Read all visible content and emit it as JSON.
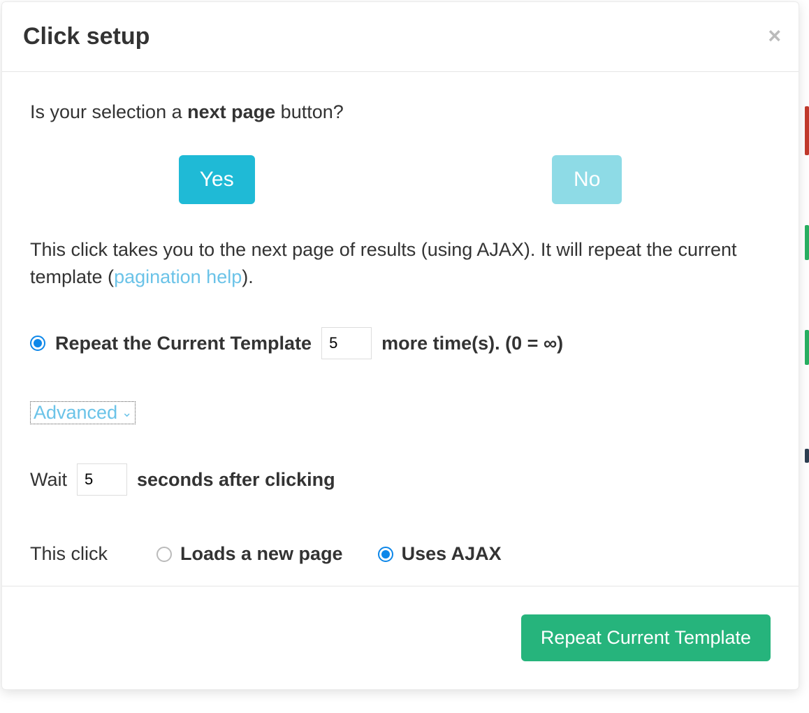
{
  "modal": {
    "title": "Click setup",
    "question_prefix": "Is your selection a ",
    "question_bold": "next page",
    "question_suffix": " button?",
    "yes_label": "Yes",
    "no_label": "No",
    "desc_part1": "This click takes you to the next page of results (using AJAX). It will repeat the current template (",
    "desc_link": "pagination help",
    "desc_part2": ").",
    "repeat_label": "Repeat the Current Template",
    "repeat_value": "5",
    "repeat_suffix": "more time(s). (0 = ∞)",
    "advanced_label": "Advanced",
    "wait_label": "Wait",
    "wait_value": "5",
    "wait_suffix": "seconds after clicking",
    "mode_label": "This click",
    "mode_newpage": "Loads a new page",
    "mode_ajax": "Uses AJAX",
    "footer_button": "Repeat Current Template"
  }
}
